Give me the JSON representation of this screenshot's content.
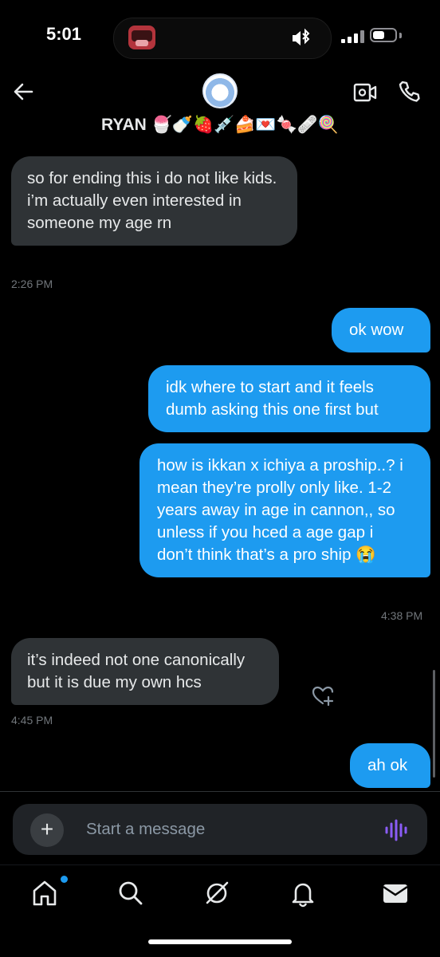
{
  "status_bar": {
    "time": "5:01"
  },
  "header": {
    "contact_name": "RYAN 🍧🍼🍓💉🍰💌🍬🩹🍭"
  },
  "messages": [
    {
      "direction": "incoming",
      "text": "so for ending this i do not like kids. i’m actually even interested in someone my age rn",
      "time": "2:26 PM"
    },
    {
      "direction": "outgoing",
      "text": "ok wow"
    },
    {
      "direction": "outgoing",
      "text": "idk where to start and it feels dumb asking this one first but"
    },
    {
      "direction": "outgoing",
      "text": "how is ikkan x ichiya a proship..? i mean they’re prolly only like. 1-2 years away in age in cannon,, so unless if you hced a age gap i don’t think that’s a pro ship 😭",
      "time": "4:38 PM"
    },
    {
      "direction": "incoming",
      "text": "it’s indeed not one canonically but it is due my own hcs",
      "time": "4:45 PM"
    },
    {
      "direction": "outgoing",
      "text": "ah ok"
    }
  ],
  "composer": {
    "placeholder": "Start a message",
    "plus_label": "+"
  },
  "nav": {
    "items": [
      {
        "icon": "home-icon",
        "has_notification": true
      },
      {
        "icon": "search-icon"
      },
      {
        "icon": "grok-icon"
      },
      {
        "icon": "bell-icon"
      },
      {
        "icon": "mail-icon"
      }
    ]
  },
  "colors": {
    "accent": "#1d9bf0",
    "incoming_bubble": "#2f3336",
    "background": "#000000"
  }
}
